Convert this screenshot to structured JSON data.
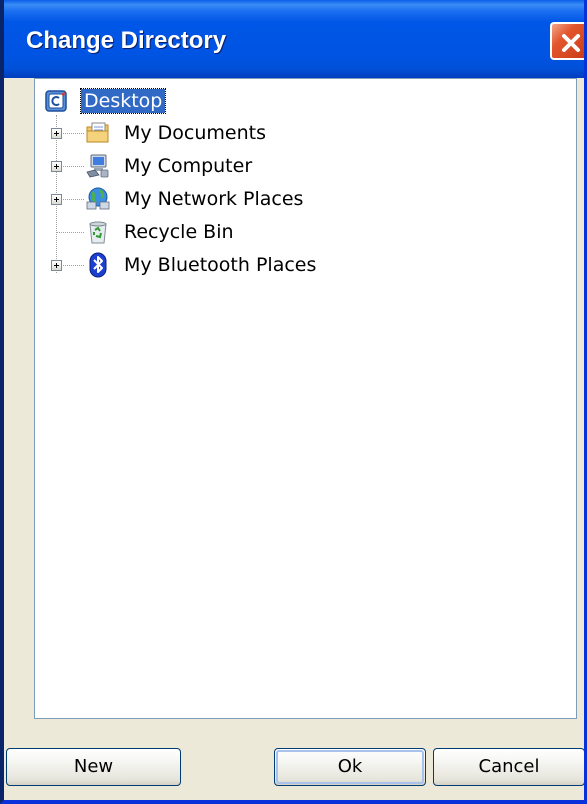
{
  "window": {
    "title": "Change Directory",
    "close_icon": "close-icon",
    "accent": "#0054e3"
  },
  "tree": {
    "root": {
      "label": "Desktop",
      "icon": "desktop-icon",
      "selected": true
    },
    "items": [
      {
        "label": "My Documents",
        "icon": "folder-documents-icon",
        "expandable": true
      },
      {
        "label": "My Computer",
        "icon": "computer-icon",
        "expandable": true
      },
      {
        "label": "My Network Places",
        "icon": "network-places-icon",
        "expandable": true
      },
      {
        "label": "Recycle Bin",
        "icon": "recycle-bin-icon",
        "expandable": false
      },
      {
        "label": "My Bluetooth Places",
        "icon": "bluetooth-icon",
        "expandable": true
      }
    ]
  },
  "buttons": {
    "new_label": "New",
    "ok_label": "Ok",
    "cancel_label": "Cancel"
  }
}
